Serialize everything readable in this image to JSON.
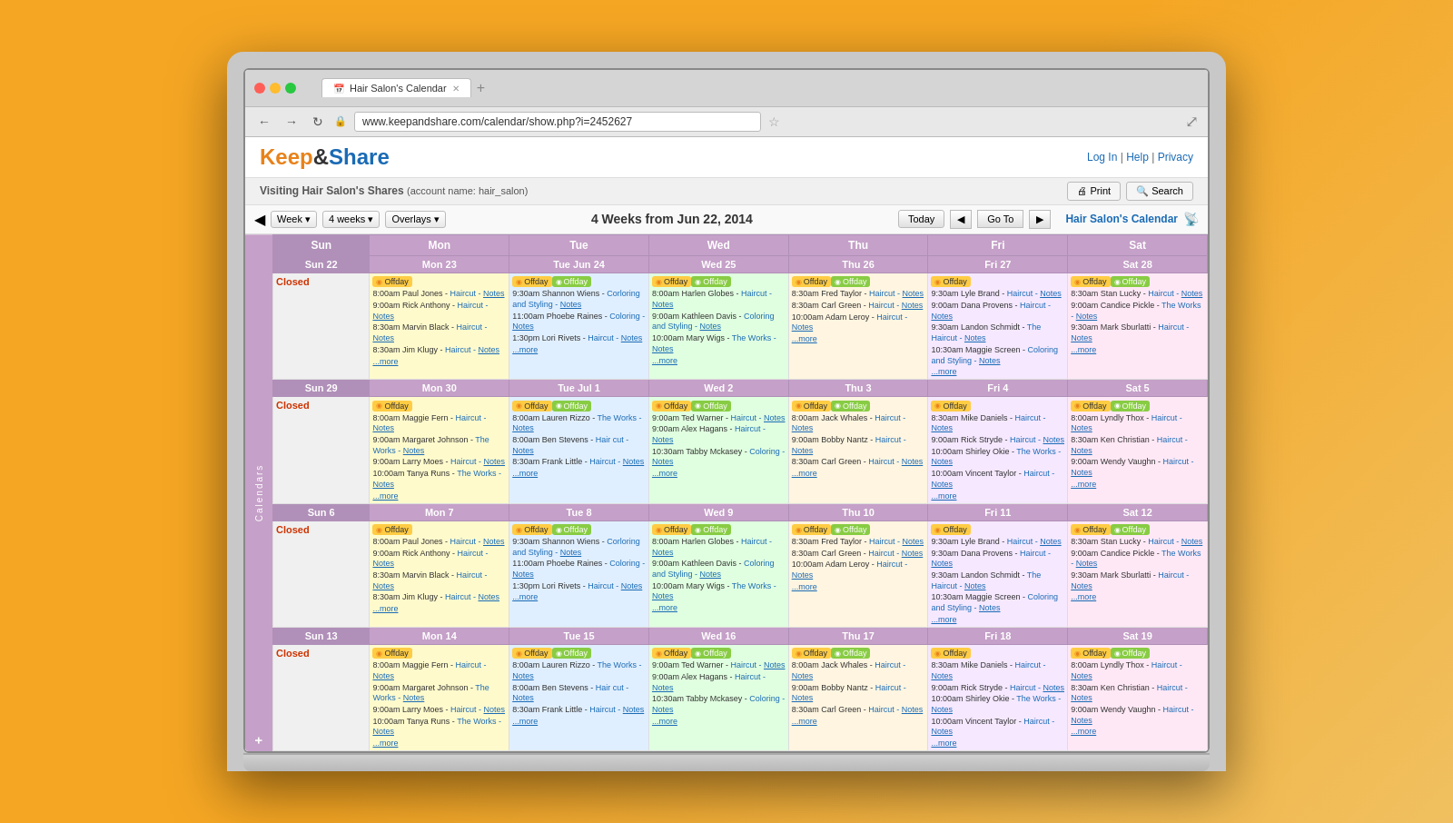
{
  "browser": {
    "tab_title": "Hair Salon's Calendar",
    "url": "www.keepandshare.com/calendar/show.php?i=2452627"
  },
  "header": {
    "logo_keep": "Keep",
    "logo_amp": "&",
    "logo_share": "Share",
    "nav_links": "Log In | Help | Privacy"
  },
  "visiting_bar": {
    "text": "Visiting Hair Salon's Shares",
    "account": "(account name: hair_salon)",
    "print_btn": "🖨 Print",
    "search_btn": "🔍 Search"
  },
  "toolbar": {
    "week_btn": "Week ▾",
    "weeks_btn": "4 weeks ▾",
    "overlays_btn": "Overlays ▾",
    "title": "4 Weeks from Jun 22, 2014",
    "today_btn": "Today",
    "prev_btn": "◀",
    "goto_btn": "Go To",
    "next_btn": "▶",
    "cal_name": "Hair Salon's Calendar",
    "rss": "RSS"
  },
  "sidebar": {
    "label": "Calendars",
    "add": "+"
  },
  "days": [
    "Sun",
    "Mon",
    "Tue",
    "Wed",
    "Thu",
    "Fri",
    "Sat"
  ],
  "weeks": [
    {
      "dates": [
        "22",
        "23",
        "24",
        "25",
        "26",
        "27",
        "28"
      ],
      "month_labels": [
        "",
        "",
        "Jun",
        "",
        "",
        "",
        ""
      ],
      "cells": [
        {
          "day": "sun",
          "date": "22",
          "closed": true,
          "events": []
        },
        {
          "day": "mon",
          "date": "23",
          "events": [
            {
              "type": "offday",
              "text": "Offday"
            },
            {
              "text": "8:00am Paul Jones - Haircut Notes"
            },
            {
              "text": "9:00am Rick Anthony - Haircut Notes"
            },
            {
              "text": "8:30am Marvin Black - Haircut Notes"
            },
            {
              "text": "8:30am Jim Klugy - Haircut Notes"
            },
            {
              "text": "more"
            }
          ]
        },
        {
          "day": "tue",
          "date": "24",
          "events": [
            {
              "type": "offday",
              "text": "Offday"
            },
            {
              "type": "offday2",
              "text": "Offday"
            },
            {
              "text": "9:30am Shannon Wiens - Corloring and Styling Notes"
            },
            {
              "text": "11:00am Phoebe Raines - Coloring Notes"
            },
            {
              "text": "1:30pm Lori Rivets - Haircut Notes"
            },
            {
              "text": "more"
            }
          ]
        },
        {
          "day": "wed",
          "date": "25",
          "events": [
            {
              "type": "offday",
              "text": "Offday"
            },
            {
              "type": "offday2",
              "text": "Offday"
            },
            {
              "text": "8:00am Harlen Globes - Haircut Notes"
            },
            {
              "text": "9:00am Kathleen Davis - Coloring and Styling Notes"
            },
            {
              "text": "10:00am Mary Wigs - The Works Notes"
            },
            {
              "text": "more"
            }
          ]
        },
        {
          "day": "thu",
          "date": "26",
          "events": [
            {
              "type": "offday",
              "text": "Offday"
            },
            {
              "type": "offday2",
              "text": "Offday"
            },
            {
              "text": "8:30am Fred Taylor - Haircut Notes"
            },
            {
              "text": "8:30am Carl Green - Haircut Notes"
            },
            {
              "text": "10:00am Adam Leroy - Haircut Notes"
            },
            {
              "text": "more"
            }
          ]
        },
        {
          "day": "fri",
          "date": "27",
          "events": [
            {
              "type": "offday",
              "text": "Offday"
            },
            {
              "text": "9:30am Lyle Brand - Haircut Notes"
            },
            {
              "text": "9:00am Dana Provens - Haircut Notes"
            },
            {
              "text": "9:30am Landon Schmidt - The Haircut Notes"
            },
            {
              "text": "10:30am Maggie Screen - Coloring and Styling Notes"
            },
            {
              "text": "more"
            }
          ]
        },
        {
          "day": "sat",
          "date": "28",
          "events": [
            {
              "type": "offday",
              "text": "Offday"
            },
            {
              "type": "offday2",
              "text": "Offday"
            },
            {
              "text": "8:30am Stan Lucky - Haircut Notes"
            },
            {
              "text": "9:00am Candice Pickle - The Works Notes"
            },
            {
              "text": "9:30am Mark Sburlatti - Haircut Notes"
            },
            {
              "text": "more"
            }
          ]
        }
      ]
    },
    {
      "dates": [
        "29",
        "30",
        "1",
        "2",
        "3",
        "4",
        "5"
      ],
      "month_labels": [
        "",
        "",
        "Jul",
        "",
        "",
        "",
        ""
      ],
      "cells": [
        {
          "day": "sun",
          "date": "29",
          "closed": true,
          "events": []
        },
        {
          "day": "mon",
          "date": "30",
          "events": [
            {
              "type": "offday",
              "text": "Offday"
            },
            {
              "text": "8:00am Maggie Fern - Haircut Notes"
            },
            {
              "text": "9:00am Margaret Johnson - The Works Notes"
            },
            {
              "text": "9:00am Larry Moes - Haircut Notes"
            },
            {
              "text": "10:00am Tanya Runs - The Works Notes"
            },
            {
              "text": "more"
            }
          ]
        },
        {
          "day": "tue",
          "date": "1",
          "events": [
            {
              "type": "offday",
              "text": "Offday"
            },
            {
              "type": "offday2",
              "text": "Offday"
            },
            {
              "text": "8:00am Lauren Rizzo - The Works Notes"
            },
            {
              "text": "8:00am Ben Stevens - Hair cut Notes"
            },
            {
              "text": "8:30am Frank Little - Haircut Notes"
            },
            {
              "text": "more"
            }
          ]
        },
        {
          "day": "wed",
          "date": "2",
          "events": [
            {
              "type": "offday",
              "text": "Offday"
            },
            {
              "type": "offday2",
              "text": "Offday"
            },
            {
              "text": "9:00am Ted Warner - Haircut Notes"
            },
            {
              "text": "9:00am Alex Hagans - Haircut Notes"
            },
            {
              "text": "10:30am Tabby Mckasey - Coloring Notes"
            },
            {
              "text": "more"
            }
          ]
        },
        {
          "day": "thu",
          "date": "3",
          "events": [
            {
              "type": "offday",
              "text": "Offday"
            },
            {
              "type": "offday2",
              "text": "Offday"
            },
            {
              "text": "8:00am Jack Whales - Haircut Notes"
            },
            {
              "text": "9:00am Bobby Nantz - Haircut Notes"
            },
            {
              "text": "8:30am Carl Green - Haircut Notes"
            },
            {
              "text": "more"
            }
          ]
        },
        {
          "day": "fri",
          "date": "4",
          "events": [
            {
              "type": "offday",
              "text": "Offday"
            },
            {
              "text": "8:30am Mike Daniels - Haircut Notes"
            },
            {
              "text": "9:00am Rick Stryde - Haircut Notes"
            },
            {
              "text": "10:00am Shirley Okie - The Works Notes"
            },
            {
              "text": "10:00am Vincent Taylor - Haircut Notes"
            },
            {
              "text": "more"
            }
          ]
        },
        {
          "day": "sat",
          "date": "5",
          "events": [
            {
              "type": "offday",
              "text": "Offday"
            },
            {
              "type": "offday2",
              "text": "Offday"
            },
            {
              "text": "8:00am Lyndly Thox - Haircut Notes"
            },
            {
              "text": "8:30am Ken Christian - Haircut Notes"
            },
            {
              "text": "9:00am Wendy Vaughn - Haircut Notes"
            },
            {
              "text": "more"
            }
          ]
        }
      ]
    },
    {
      "dates": [
        "6",
        "7",
        "8",
        "9",
        "10",
        "11",
        "12"
      ],
      "month_labels": [
        "",
        "",
        "",
        "",
        "",
        "",
        ""
      ],
      "cells": [
        {
          "day": "sun",
          "date": "6",
          "closed": true,
          "events": []
        },
        {
          "day": "mon",
          "date": "7",
          "events": [
            {
              "type": "offday",
              "text": "Offday"
            },
            {
              "text": "8:00am Paul Jones - Haircut Notes"
            },
            {
              "text": "9:00am Rick Anthony - Haircut Notes"
            },
            {
              "text": "8:30am Marvin Black - Haircut Notes"
            },
            {
              "text": "8:30am Jim Klugy - Haircut Notes"
            },
            {
              "text": "more"
            }
          ]
        },
        {
          "day": "tue",
          "date": "8",
          "events": [
            {
              "type": "offday",
              "text": "Offday"
            },
            {
              "type": "offday2",
              "text": "Offday"
            },
            {
              "text": "9:30am Shannon Wiens - Corloring and Styling Notes"
            },
            {
              "text": "11:00am Phoebe Raines - Coloring Notes"
            },
            {
              "text": "1:30pm Lori Rivets - Haircut Notes"
            },
            {
              "text": "more"
            }
          ]
        },
        {
          "day": "wed",
          "date": "9",
          "events": [
            {
              "type": "offday",
              "text": "Offday"
            },
            {
              "type": "offday2",
              "text": "Offday"
            },
            {
              "text": "8:00am Harlen Globes - Haircut Notes"
            },
            {
              "text": "9:00am Kathleen Davis - Coloring and Styling Notes"
            },
            {
              "text": "10:00am Mary Wigs - The Works Notes"
            },
            {
              "text": "more"
            }
          ]
        },
        {
          "day": "thu",
          "date": "10",
          "events": [
            {
              "type": "offday",
              "text": "Offday"
            },
            {
              "type": "offday2",
              "text": "Offday"
            },
            {
              "text": "8:30am Fred Taylor - Haircut Notes"
            },
            {
              "text": "8:30am Carl Green - Haircut Notes"
            },
            {
              "text": "10:00am Adam Leroy - Haircut Notes"
            },
            {
              "text": "more"
            }
          ]
        },
        {
          "day": "fri",
          "date": "11",
          "events": [
            {
              "type": "offday",
              "text": "Offday"
            },
            {
              "text": "9:30am Lyle Brand - Haircut Notes"
            },
            {
              "text": "9:30am Dana Provens - Haircut Notes"
            },
            {
              "text": "9:30am Landon Schmidt - The Haircut Notes"
            },
            {
              "text": "10:30am Maggie Screen - Coloring and Styling Notes"
            },
            {
              "text": "more"
            }
          ]
        },
        {
          "day": "sat",
          "date": "12",
          "events": [
            {
              "type": "offday",
              "text": "Offday"
            },
            {
              "type": "offday2",
              "text": "Offday"
            },
            {
              "text": "8:30am Stan Lucky - Haircut Notes"
            },
            {
              "text": "9:00am Candice Pickle - The Works Notes"
            },
            {
              "text": "9:30am Mark Sburlatti - Haircut Notes"
            },
            {
              "text": "more"
            }
          ]
        }
      ]
    },
    {
      "dates": [
        "13",
        "14",
        "15",
        "16",
        "17",
        "18",
        "19"
      ],
      "month_labels": [
        "",
        "",
        "",
        "",
        "",
        "",
        ""
      ],
      "cells": [
        {
          "day": "sun",
          "date": "13",
          "closed": true,
          "events": []
        },
        {
          "day": "mon",
          "date": "14",
          "events": [
            {
              "type": "offday",
              "text": "Offday"
            },
            {
              "text": "8:00am Maggie Fern - Haircut Notes"
            },
            {
              "text": "9:00am Margaret Johnson - The Works Notes"
            },
            {
              "text": "9:00am Larry Moes - Haircut Notes"
            },
            {
              "text": "10:00am Tanya Runs - The Works Notes"
            },
            {
              "text": "more"
            }
          ]
        },
        {
          "day": "tue",
          "date": "15",
          "events": [
            {
              "type": "offday",
              "text": "Offday"
            },
            {
              "type": "offday2",
              "text": "Offday"
            },
            {
              "text": "8:00am Lauren Rizzo - The Works Notes"
            },
            {
              "text": "8:00am Ben Stevens - Hair cut Notes"
            },
            {
              "text": "8:30am Frank Little - Haircut Notes"
            },
            {
              "text": "more"
            }
          ]
        },
        {
          "day": "wed",
          "date": "16",
          "events": [
            {
              "type": "offday",
              "text": "Offday"
            },
            {
              "type": "offday2",
              "text": "Offday"
            },
            {
              "text": "9:00am Ted Warner - Haircut Notes"
            },
            {
              "text": "9:00am Alex Hagans - Haircut Notes"
            },
            {
              "text": "10:30am Tabby Mckasey - Coloring Notes"
            },
            {
              "text": "more"
            }
          ]
        },
        {
          "day": "thu",
          "date": "17",
          "events": [
            {
              "type": "offday",
              "text": "Offday"
            },
            {
              "type": "offday2",
              "text": "Offday"
            },
            {
              "text": "8:00am Jack Whales - Haircut Notes"
            },
            {
              "text": "9:00am Bobby Nantz - Haircut Notes"
            },
            {
              "text": "8:30am Carl Green - Haircut Notes"
            },
            {
              "text": "more"
            }
          ]
        },
        {
          "day": "fri",
          "date": "18",
          "events": [
            {
              "type": "offday",
              "text": "Offday"
            },
            {
              "text": "8:30am Mike Daniels - Haircut Notes"
            },
            {
              "text": "9:00am Rick Stryde - Haircut Notes"
            },
            {
              "text": "10:00am Shirley Okie - The Works Notes"
            },
            {
              "text": "10:00am Vincent Taylor - Haircut Notes"
            },
            {
              "text": "more"
            }
          ]
        },
        {
          "day": "sat",
          "date": "19",
          "events": [
            {
              "type": "offday",
              "text": "Offday"
            },
            {
              "type": "offday2",
              "text": "Offday"
            },
            {
              "text": "8:00am Lyndly Thox - Haircut Notes"
            },
            {
              "text": "8:30am Ken Christian - Haircut Notes"
            },
            {
              "text": "9:00am Wendy Vaughn - Haircut Notes"
            },
            {
              "text": "more"
            }
          ]
        }
      ]
    }
  ]
}
